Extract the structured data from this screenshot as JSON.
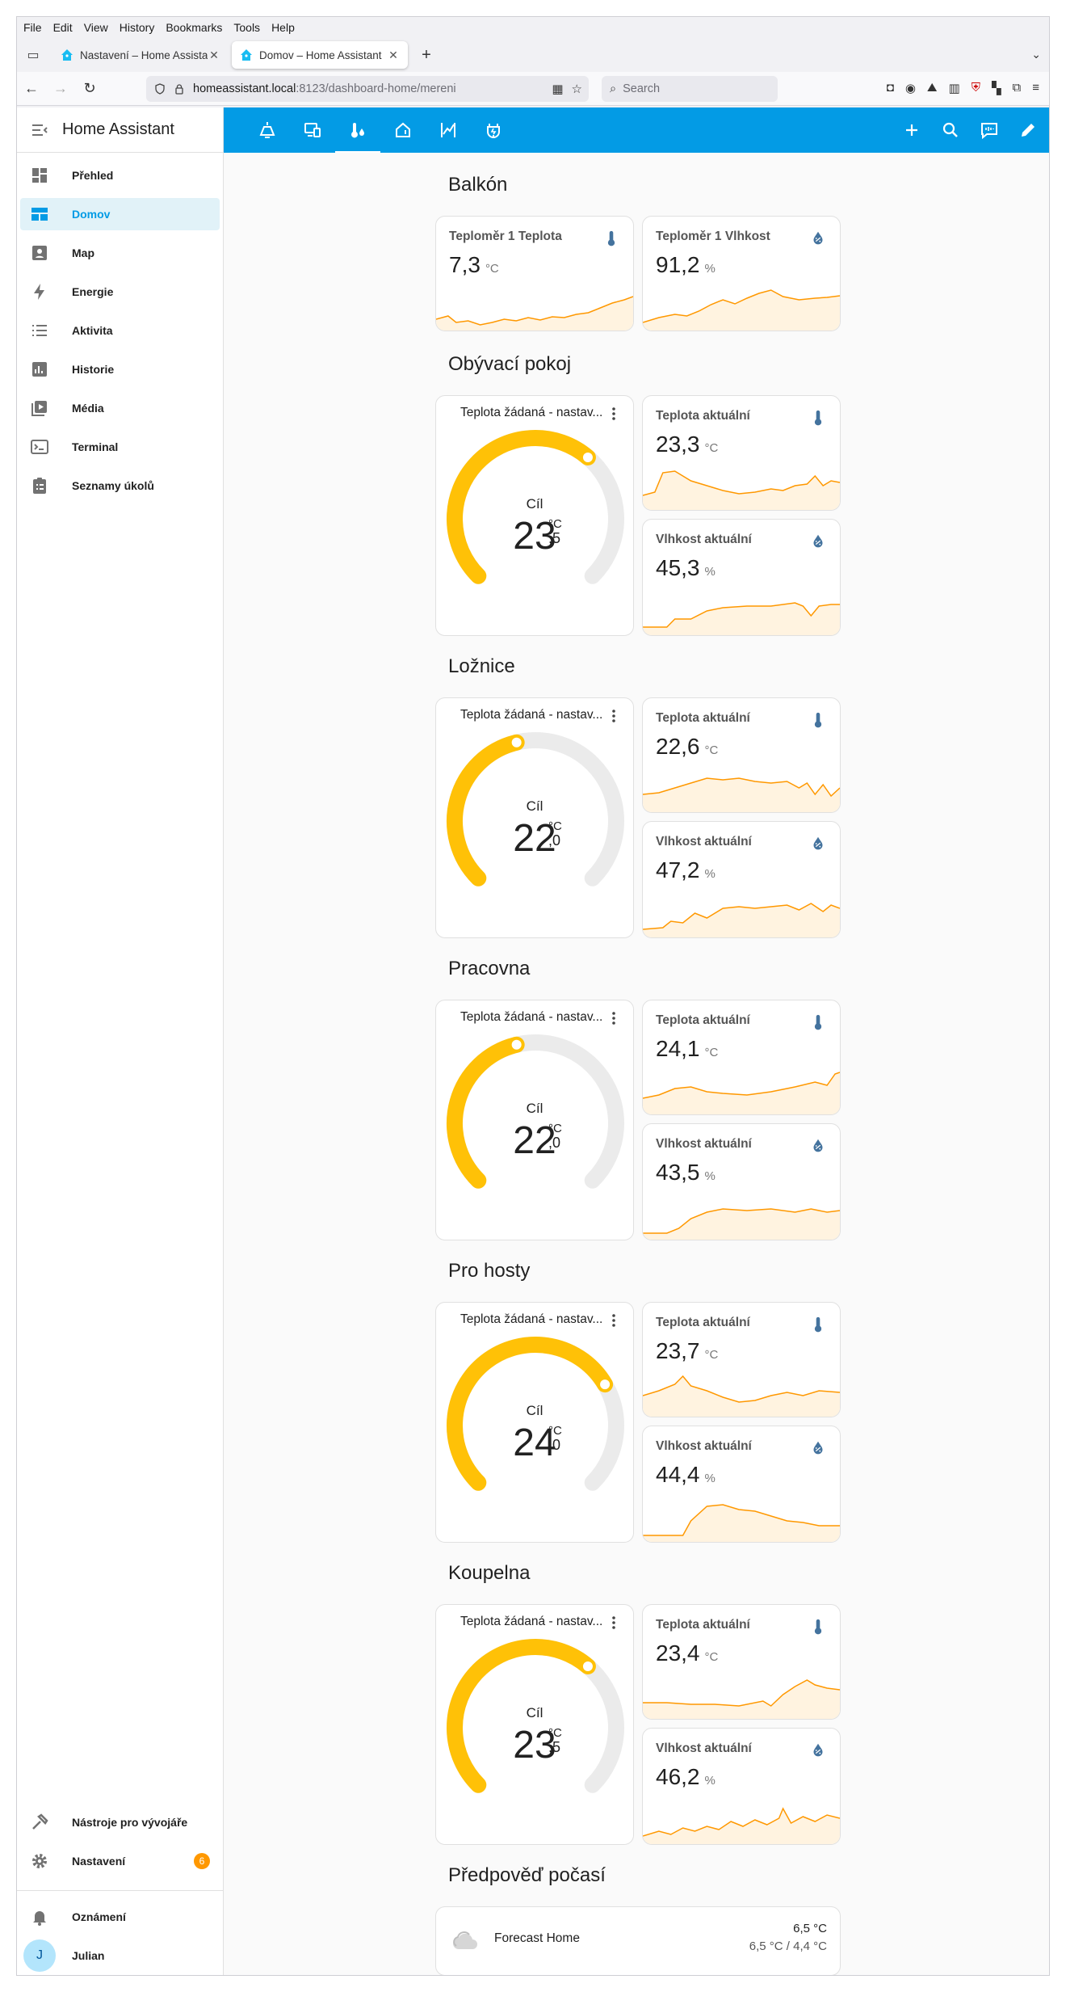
{
  "browser": {
    "menu": [
      "File",
      "Edit",
      "View",
      "History",
      "Bookmarks",
      "Tools",
      "Help"
    ],
    "tabs": [
      {
        "title": "Nastavení – Home Assistant",
        "active": false
      },
      {
        "title": "Domov – Home Assistant",
        "active": true
      }
    ],
    "url_host": "homeassistant.local",
    "url_path": ":8123/dashboard-home/mereni",
    "search_placeholder": "Search"
  },
  "sidebar": {
    "title": "Home Assistant",
    "items": [
      {
        "label": "Přehled",
        "icon": "dashboard-icon"
      },
      {
        "label": "Domov",
        "icon": "view-dashboard-icon",
        "active": true
      },
      {
        "label": "Map",
        "icon": "map-icon"
      },
      {
        "label": "Energie",
        "icon": "lightning-icon"
      },
      {
        "label": "Aktivita",
        "icon": "list-icon"
      },
      {
        "label": "Historie",
        "icon": "chart-bar-icon"
      },
      {
        "label": "Média",
        "icon": "media-icon"
      },
      {
        "label": "Terminal",
        "icon": "terminal-icon"
      },
      {
        "label": "Seznamy úkolů",
        "icon": "clipboard-list-icon"
      }
    ],
    "dev_tools": "Nástroje pro vývojáře",
    "settings": "Nastavení",
    "settings_badge": "6",
    "notifications": "Oznámení",
    "user": "Julian",
    "user_initial": "J"
  },
  "colors": {
    "primary": "#039be5",
    "gauge": "#ffc107",
    "graph": "#ff9800",
    "graph_fill": "#fff3e0",
    "icon_blue": "#44739e"
  },
  "sections": {
    "balkon": {
      "title": "Balkón",
      "temp": {
        "name": "Teploměr 1 Teplota",
        "value": "7,3",
        "unit": "°C"
      },
      "hum": {
        "name": "Teploměr 1 Vlhkost",
        "value": "91,2",
        "unit": "%"
      }
    },
    "obyvaci": {
      "title": "Obývací pokoj",
      "thermo": {
        "name": "Teplota žádaná - nastav...",
        "label": "Cíl",
        "int": "23",
        "dec": ",5",
        "unit": "°C",
        "level": 0.65
      },
      "temp": {
        "name": "Teplota aktuální",
        "value": "23,3",
        "unit": "°C"
      },
      "hum": {
        "name": "Vlhkost aktuální",
        "value": "45,3",
        "unit": "%"
      }
    },
    "loznice": {
      "title": "Ložnice",
      "thermo": {
        "name": "Teplota žádaná - nastav...",
        "label": "Cíl",
        "int": "22",
        "dec": ",0",
        "unit": "°C",
        "level": 0.45
      },
      "temp": {
        "name": "Teplota aktuální",
        "value": "22,6",
        "unit": "°C"
      },
      "hum": {
        "name": "Vlhkost aktuální",
        "value": "47,2",
        "unit": "%"
      }
    },
    "pracovna": {
      "title": "Pracovna",
      "thermo": {
        "name": "Teplota žádaná - nastav...",
        "label": "Cíl",
        "int": "22",
        "dec": ",0",
        "unit": "°C",
        "level": 0.45
      },
      "temp": {
        "name": "Teplota aktuální",
        "value": "24,1",
        "unit": "°C"
      },
      "hum": {
        "name": "Vlhkost aktuální",
        "value": "43,5",
        "unit": "%"
      }
    },
    "hoste": {
      "title": "Pro hosty",
      "thermo": {
        "name": "Teplota žádaná - nastav...",
        "label": "Cíl",
        "int": "24",
        "dec": ",0",
        "unit": "°C",
        "level": 0.72
      },
      "temp": {
        "name": "Teplota aktuální",
        "value": "23,7",
        "unit": "°C"
      },
      "hum": {
        "name": "Vlhkost aktuální",
        "value": "44,4",
        "unit": "%"
      }
    },
    "koupelna": {
      "title": "Koupelna",
      "thermo": {
        "name": "Teplota žádaná - nastav...",
        "label": "Cíl",
        "int": "23",
        "dec": ",5",
        "unit": "°C",
        "level": 0.65
      },
      "temp": {
        "name": "Teplota aktuální",
        "value": "23,4",
        "unit": "°C"
      },
      "hum": {
        "name": "Vlhkost aktuální",
        "value": "46,2",
        "unit": "%"
      }
    },
    "forecast": {
      "title": "Předpověď počasí",
      "name": "Forecast Home",
      "temp": "6,5 °C",
      "range": "6,5 °C / 4,4 °C"
    }
  }
}
